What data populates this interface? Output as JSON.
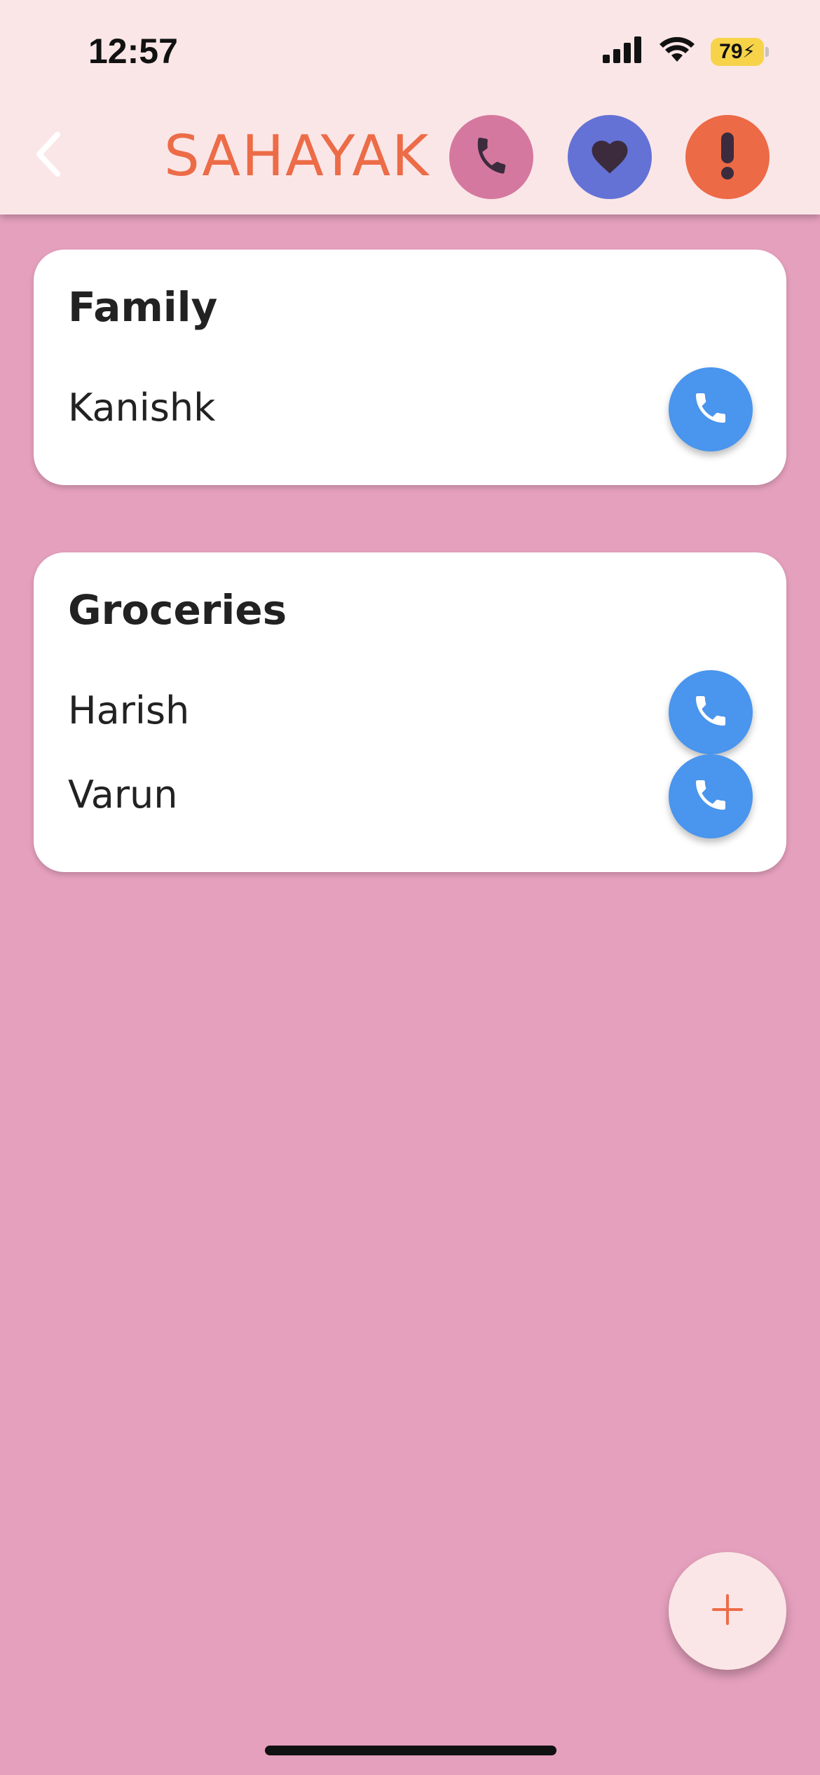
{
  "status_bar": {
    "time": "12:57",
    "battery": "79"
  },
  "header": {
    "title": "SAHAYAK",
    "icons": [
      "chevron-left-icon",
      "phone-icon",
      "heart-icon",
      "exclamation-icon"
    ]
  },
  "groups": [
    {
      "title": "Family",
      "contacts": [
        {
          "name": "Kanishk"
        }
      ]
    },
    {
      "title": "Groceries",
      "contacts": [
        {
          "name": "Harish"
        },
        {
          "name": "Varun"
        }
      ]
    }
  ],
  "fab": {
    "icon": "plus-icon"
  },
  "colors": {
    "background": "#e5a0bd",
    "header_bg": "#fbe6e7",
    "title": "#ec6c48",
    "call_button": "#4a95ed",
    "phone_btn": "#d5789f",
    "heart_btn": "#6472d6",
    "alert_btn": "#ec6a46"
  }
}
